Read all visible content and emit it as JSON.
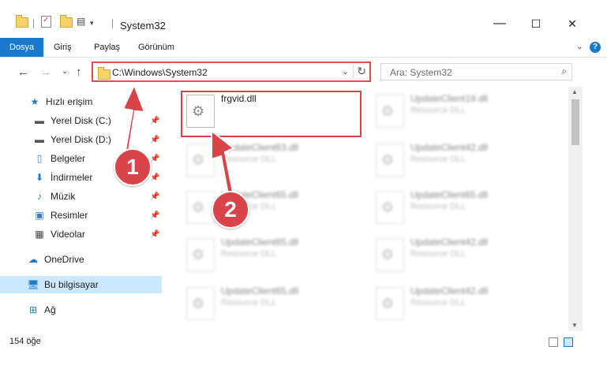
{
  "window": {
    "title": "System32",
    "minimize": "—",
    "maximize": "☐",
    "close": "✕"
  },
  "ribbon": {
    "tabs": [
      "Dosya",
      "Giriş",
      "Paylaş",
      "Görünüm"
    ],
    "help": "?",
    "collapse": "⌄"
  },
  "nav": {
    "back": "←",
    "forward": "→",
    "dropdown": "⌄",
    "up": "↑"
  },
  "address": {
    "path": "C:\\Windows\\System32",
    "dropdown": "⌄",
    "refresh": "↻"
  },
  "search": {
    "placeholder": "Ara: System32"
  },
  "sidebar": {
    "items": [
      {
        "label": "Hızlı erişim",
        "icon": "star-icon",
        "pinned": false
      },
      {
        "label": "Yerel Disk (C:)",
        "icon": "drive-icon",
        "pinned": true
      },
      {
        "label": "Yerel Disk (D:)",
        "icon": "drive-icon",
        "pinned": true
      },
      {
        "label": "Belgeler",
        "icon": "documents-icon",
        "pinned": true
      },
      {
        "label": "İndirmeler",
        "icon": "download-icon",
        "pinned": true
      },
      {
        "label": "Müzik",
        "icon": "music-icon",
        "pinned": true
      },
      {
        "label": "Resimler",
        "icon": "pictures-icon",
        "pinned": true
      },
      {
        "label": "Videolar",
        "icon": "video-icon",
        "pinned": true
      },
      {
        "label": "OneDrive",
        "icon": "cloud-icon",
        "pinned": false
      },
      {
        "label": "Bu bilgisayar",
        "icon": "computer-icon",
        "pinned": false,
        "selected": true
      },
      {
        "label": "Ağ",
        "icon": "network-icon",
        "pinned": false
      }
    ]
  },
  "files": [
    {
      "name": "frgvid.dll",
      "desc": "",
      "blurred": false
    },
    {
      "name": "UpdateClient19.dll",
      "desc": "Resource DLL",
      "blurred": true
    },
    {
      "name": "UpdateClient63.dll",
      "desc": "Resource DLL",
      "blurred": true
    },
    {
      "name": "UpdateClient42.dll",
      "desc": "Resource DLL",
      "blurred": true
    },
    {
      "name": "UpdateClient65.dll",
      "desc": "Resource DLL",
      "blurred": true
    },
    {
      "name": "UpdateClient65.dll",
      "desc": "Resource DLL",
      "blurred": true
    },
    {
      "name": "UpdateClient65.dll",
      "desc": "Resource DLL",
      "blurred": true
    },
    {
      "name": "UpdateClient42.dll",
      "desc": "Resource DLL",
      "blurred": true
    },
    {
      "name": "UpdateClient65.dll",
      "desc": "Resource DLL",
      "blurred": true
    },
    {
      "name": "UpdateClient42.dll",
      "desc": "Resource DLL",
      "blurred": true
    }
  ],
  "status": {
    "count": "154 öğe"
  },
  "annotations": {
    "badge1": "1",
    "badge2": "2"
  },
  "colors": {
    "accent": "#1979ca",
    "highlight": "#d9434a",
    "selected": "#cce8ff"
  }
}
